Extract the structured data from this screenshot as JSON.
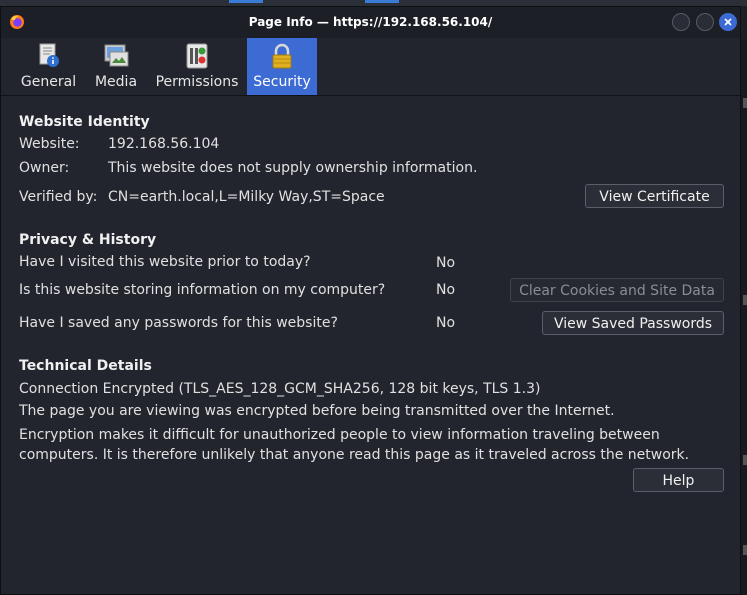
{
  "window": {
    "title": "Page Info — https://192.168.56.104/"
  },
  "tabs": [
    {
      "label": "General",
      "icon": "info-page-icon"
    },
    {
      "label": "Media",
      "icon": "media-icon"
    },
    {
      "label": "Permissions",
      "icon": "permissions-icon"
    },
    {
      "label": "Security",
      "icon": "lock-icon",
      "active": true
    }
  ],
  "identity": {
    "heading": "Website Identity",
    "website_label": "Website:",
    "website_value": "192.168.56.104",
    "owner_label": "Owner:",
    "owner_value": "This website does not supply ownership information.",
    "verified_label": "Verified by:",
    "verified_value": "CN=earth.local,L=Milky Way,ST=Space",
    "view_certificate": "View Certificate"
  },
  "privacy": {
    "heading": "Privacy & History",
    "q1": "Have I visited this website prior to today?",
    "a1": "No",
    "q2": "Is this website storing information on my computer?",
    "a2": "No",
    "clear_cookies": "Clear Cookies and Site Data",
    "q3": "Have I saved any passwords for this website?",
    "a3": "No",
    "view_passwords": "View Saved Passwords"
  },
  "technical": {
    "heading": "Technical Details",
    "line1": "Connection Encrypted (TLS_AES_128_GCM_SHA256, 128 bit keys, TLS 1.3)",
    "line2": "The page you are viewing was encrypted before being transmitted over the Internet.",
    "line3": "Encryption makes it difficult for unauthorized people to view information traveling between computers. It is therefore unlikely that anyone read this page as it traveled across the network."
  },
  "help_button": "Help",
  "colors": {
    "accent": "#3d6bd4",
    "background": "#22252e"
  }
}
